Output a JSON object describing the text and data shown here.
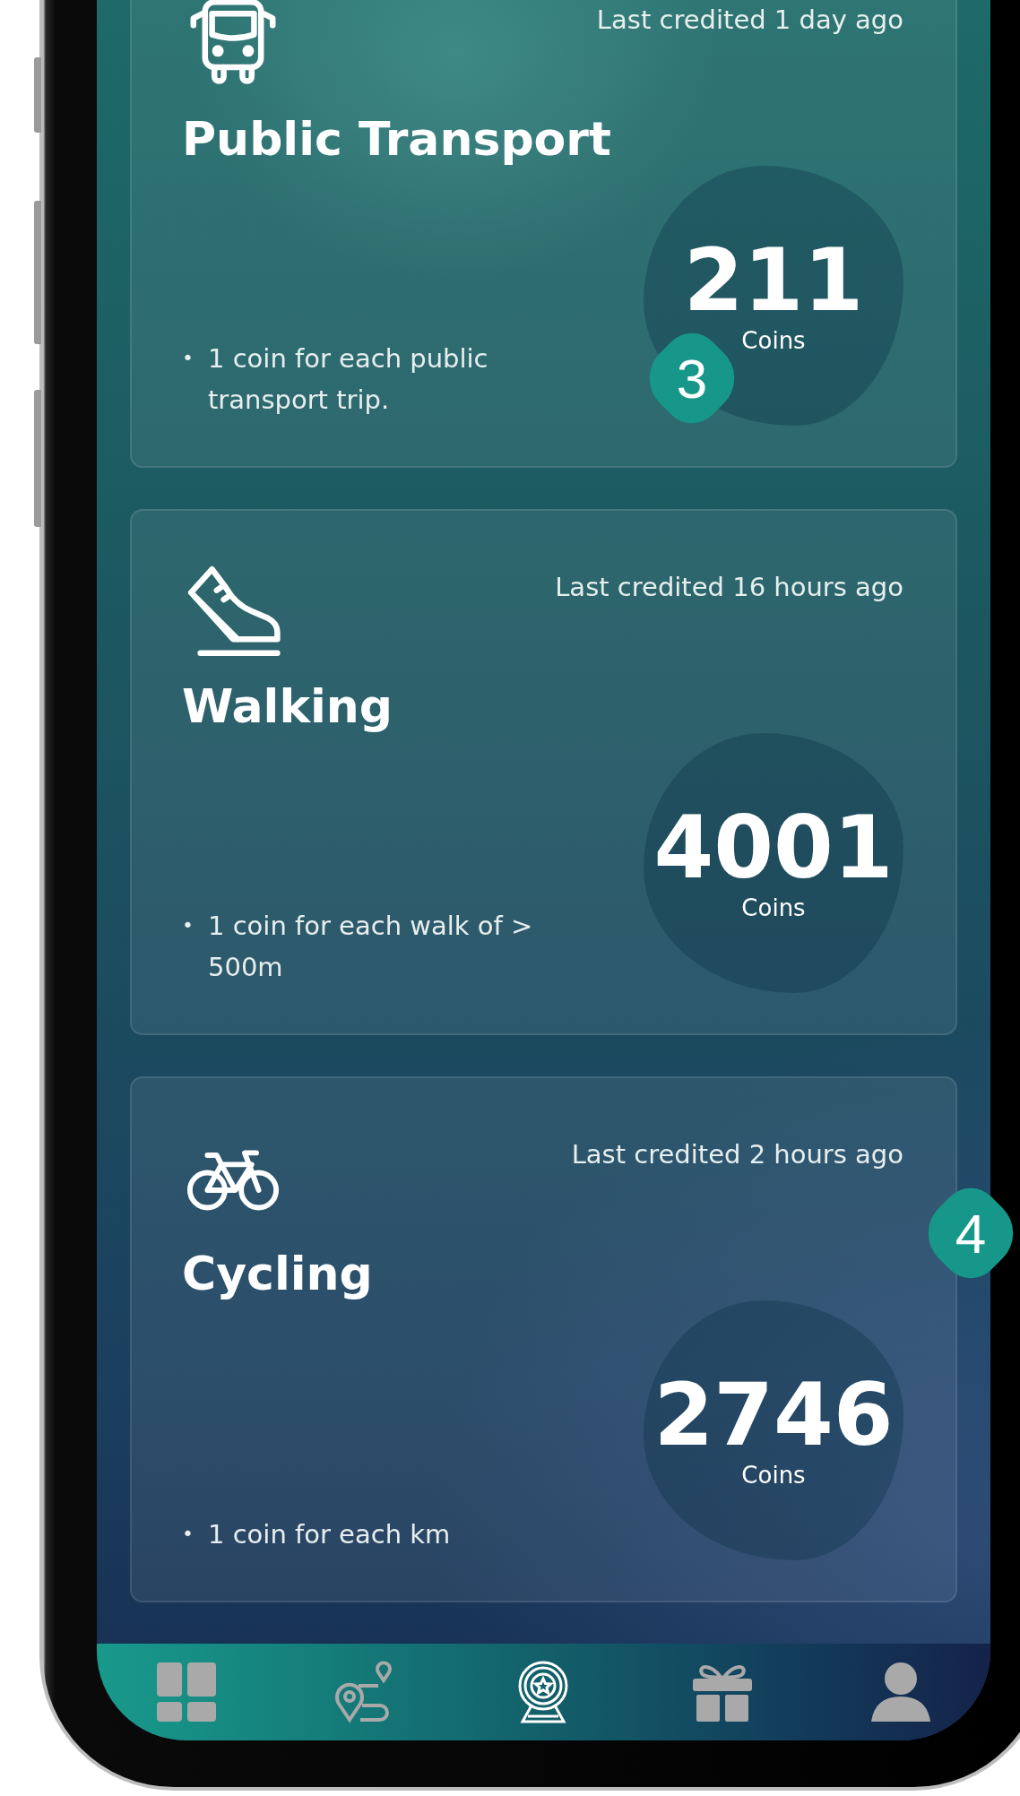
{
  "cards": [
    {
      "kind": "bus",
      "credited": "Last credited 1 day ago",
      "title": "Public Transport",
      "coins": "211",
      "unit": "Coins",
      "bullet": "•",
      "rule": "1 coin for each public transport trip.",
      "marker": "3"
    },
    {
      "kind": "walk",
      "credited": "Last credited 16 hours ago",
      "title": "Walking",
      "coins": "4001",
      "unit": "Coins",
      "bullet": "•",
      "rule": "1 coin for each walk of  > 500m"
    },
    {
      "kind": "bike",
      "credited": "Last credited 2 hours ago",
      "title": "Cycling",
      "coins": "2746",
      "unit": "Coins",
      "bullet": "•",
      "rule": "1 coin for each km",
      "marker": "4"
    }
  ],
  "nav": [
    {
      "kind": "dashboard",
      "selected": false
    },
    {
      "kind": "route",
      "selected": false
    },
    {
      "kind": "award",
      "selected": true
    },
    {
      "kind": "gift",
      "selected": false
    },
    {
      "kind": "profile",
      "selected": false
    }
  ]
}
